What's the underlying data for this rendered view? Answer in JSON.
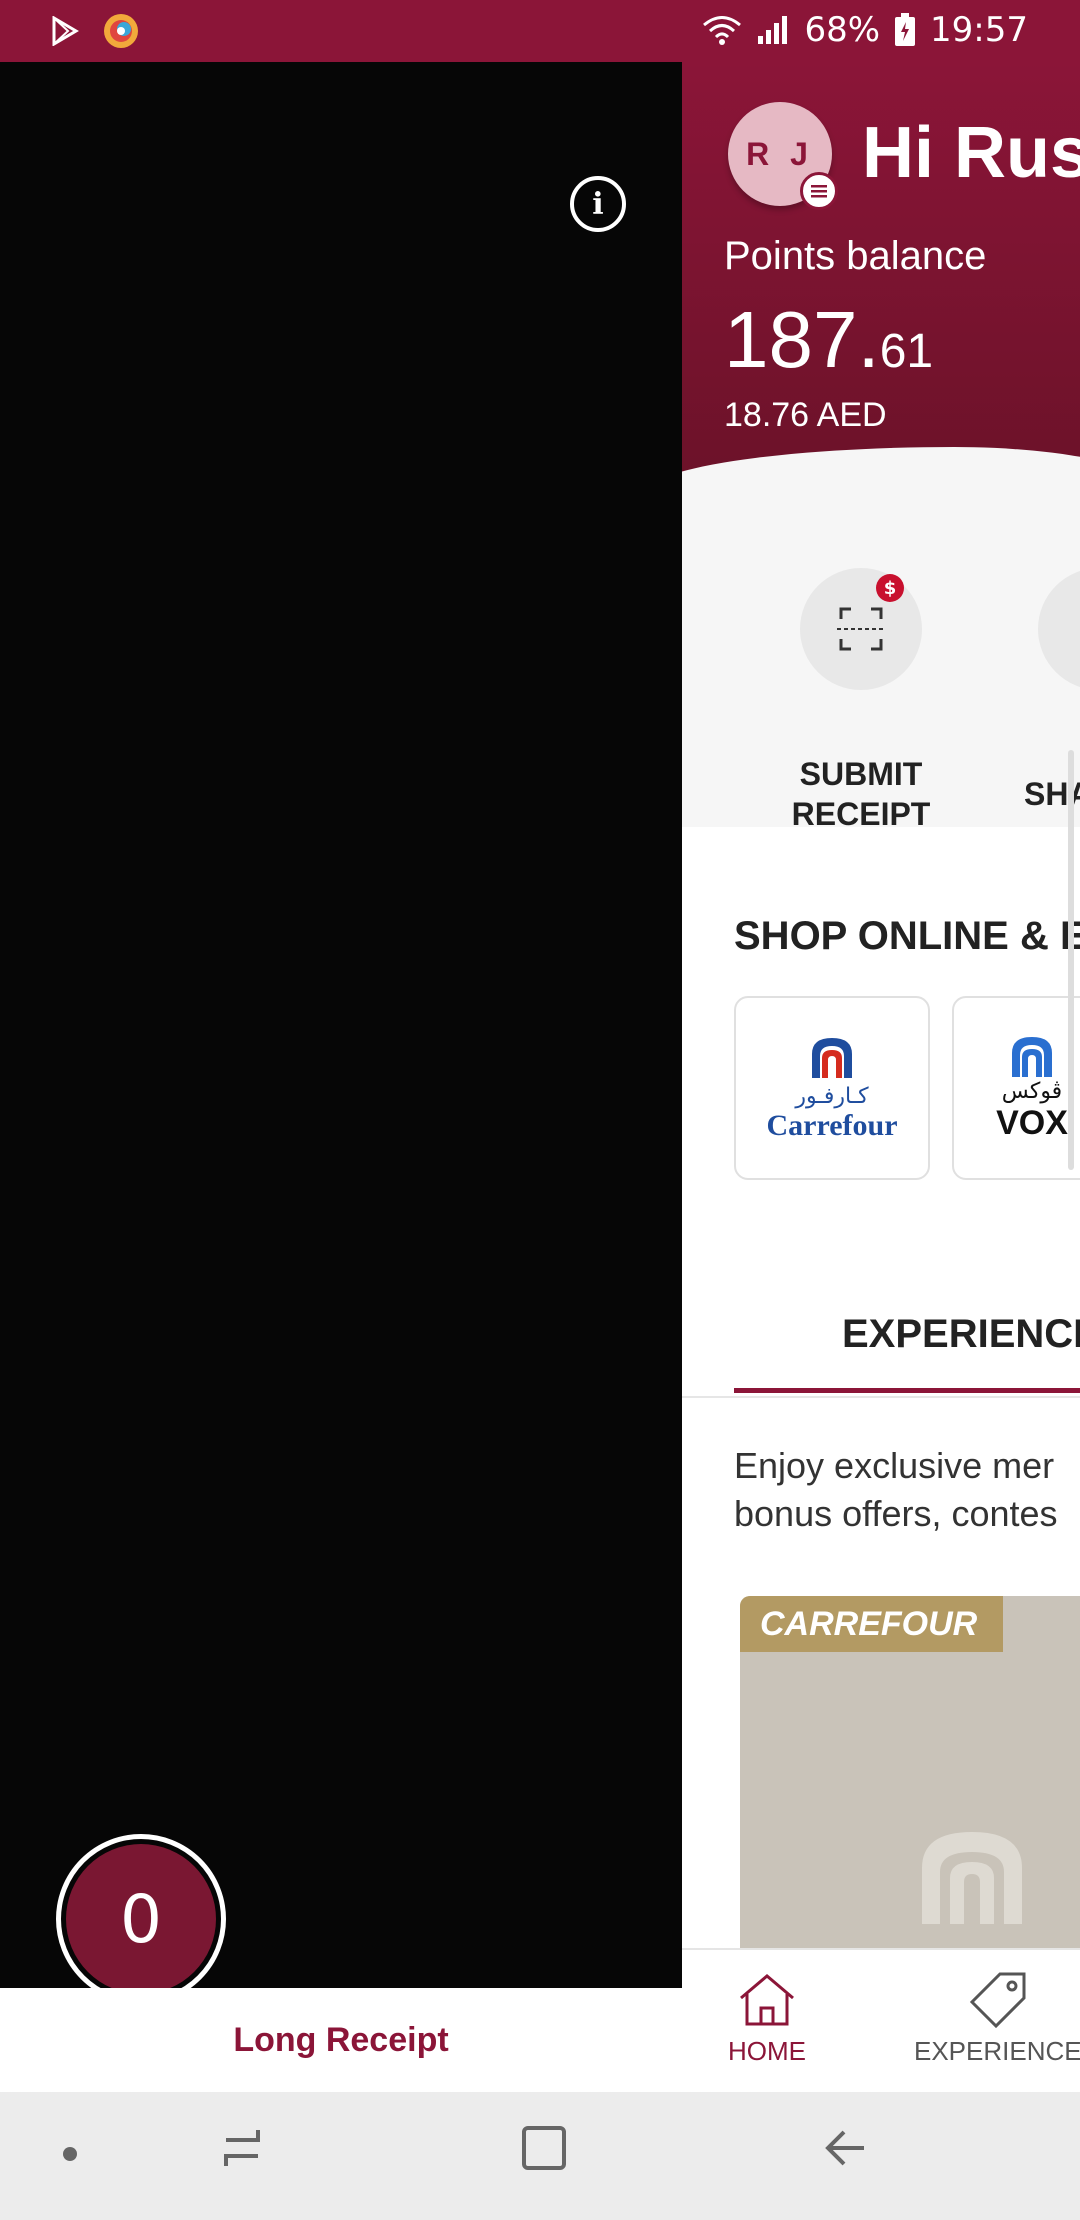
{
  "status_bar": {
    "battery": "68%",
    "time": "19:57"
  },
  "camera": {
    "counter": "0"
  },
  "long_receipt": {
    "label": "Long Receipt"
  },
  "profile": {
    "initials": "R J",
    "greeting": "Hi Rus"
  },
  "points": {
    "label": "Points balance",
    "whole": "187.",
    "decimal": "61",
    "aed": "18.76 AED"
  },
  "actions": [
    {
      "label_line1": "SUBMIT",
      "label_line2": "RECEIPT"
    },
    {
      "label_line1": "SHA",
      "label_line2": ""
    }
  ],
  "shop": {
    "title": "SHOP ONLINE & E",
    "brands": [
      {
        "arabic": "كـارفـور",
        "name": "Carrefour"
      },
      {
        "arabic": "ڤوكس",
        "name": "VOX"
      }
    ]
  },
  "tabs": {
    "active": "EXPERIENCE"
  },
  "description": {
    "line1": "Enjoy exclusive mer",
    "line2": "bonus offers, contes"
  },
  "promo": {
    "tag": "CARREFOUR"
  },
  "bottom_nav": {
    "home": "HOME",
    "experiences": "EXPERIENCE"
  },
  "colors": {
    "brand": "#8b1538",
    "promo_tag": "#b39a63"
  }
}
